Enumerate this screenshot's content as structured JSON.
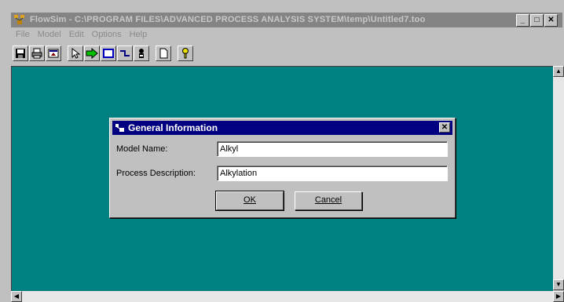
{
  "window": {
    "title": "FlowSim - C:\\PROGRAM FILES\\ADVANCED PROCESS ANALYSIS SYSTEM\\temp\\Untitled7.too",
    "minimize_label": "_",
    "maximize_label": "□",
    "close_label": "✕"
  },
  "menu": {
    "items": [
      "File",
      "Model",
      "Edit",
      "Options",
      "Help"
    ]
  },
  "toolbar": {
    "buttons": [
      "save-icon",
      "print-icon",
      "export-icon",
      "pointer-icon",
      "process-unit-icon",
      "box-icon",
      "stream-icon",
      "stack-icon",
      "page-icon",
      "help-icon"
    ]
  },
  "dialog": {
    "title": "General Information",
    "close_label": "✕",
    "model_name_label": "Model Name:",
    "model_name_value": "Alkyl",
    "process_description_label": "Process Description:",
    "process_description_value": "Alkylation",
    "ok_label": "OK",
    "cancel_label": "Cancel"
  },
  "colors": {
    "workspace": "#008080",
    "dialog_title": "#000080",
    "chrome": "#c0c0c0"
  }
}
